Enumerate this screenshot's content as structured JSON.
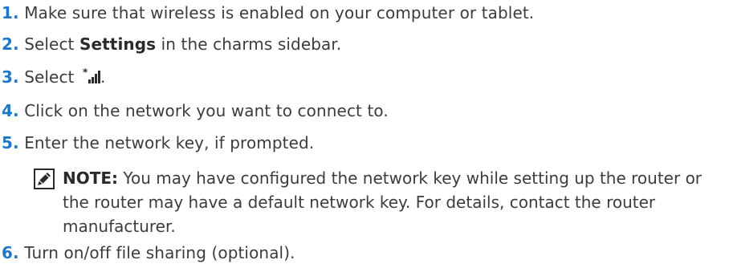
{
  "steps": [
    {
      "num": "1.",
      "text": "Make sure that wireless is enabled on your computer or tablet."
    },
    {
      "num": "2.",
      "pre": "Select ",
      "bold": "Settings",
      "post": " in the charms sidebar."
    },
    {
      "num": "3.",
      "pre": "Select ",
      "post": ".",
      "icon": "wireless-signal-icon"
    },
    {
      "num": "4.",
      "text": "Click on the network you want to connect to."
    },
    {
      "num": "5.",
      "text": "Enter the network key, if prompted."
    },
    {
      "num": "6.",
      "text": "Turn on/off file sharing (optional)."
    }
  ],
  "note": {
    "icon": "note-pencil-icon",
    "label": "NOTE:",
    "text": " You may have configured the network key while setting up the router or the router may have a default network key. For details, contact the router manufacturer."
  },
  "colors": {
    "step_number": "#1e78c8",
    "body_text": "#3c3c3c"
  }
}
